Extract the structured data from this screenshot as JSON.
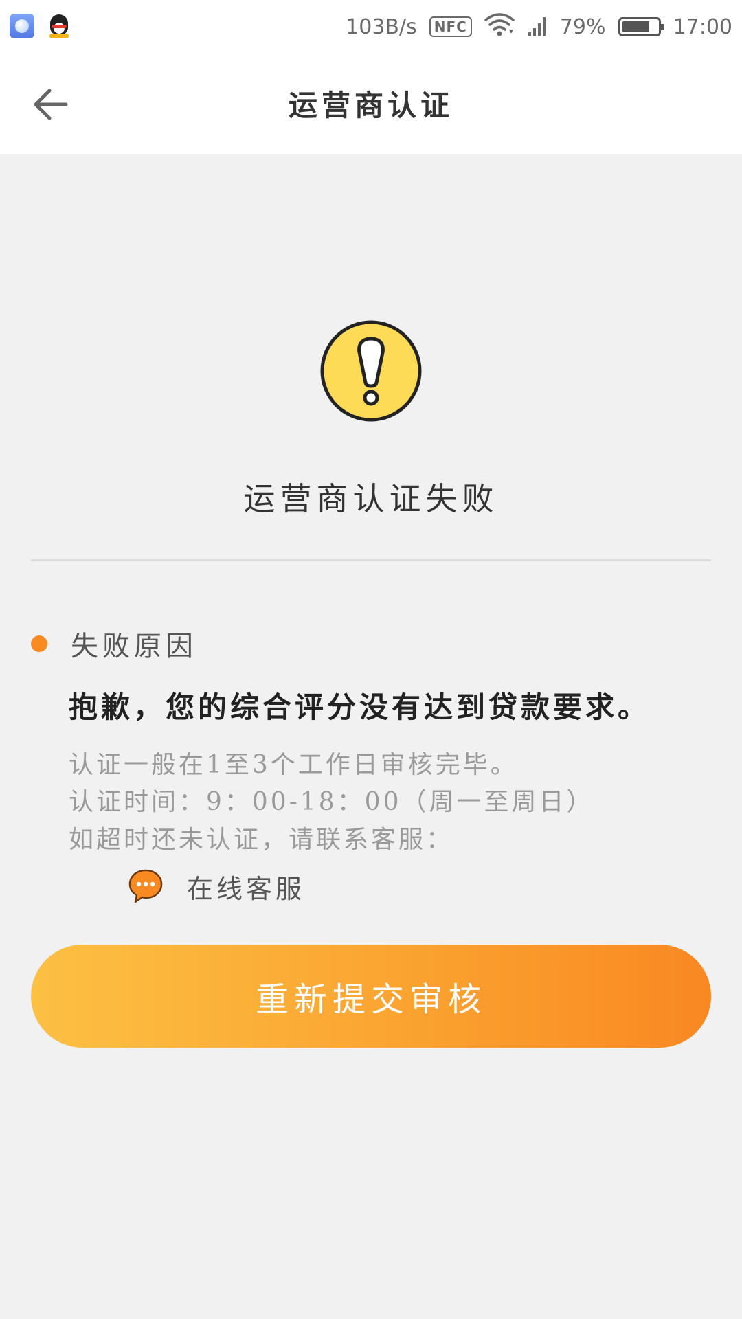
{
  "status_bar": {
    "net_speed": "103B/s",
    "nfc": "NFC",
    "battery_percent": "79%",
    "battery_level": 0.79,
    "time": "17:00",
    "left_icons": [
      "browser-app-icon",
      "qq-app-icon"
    ],
    "right_icons": [
      "wifi-icon",
      "signal-icon",
      "battery-icon"
    ]
  },
  "app_bar": {
    "back_icon": "arrow-left-icon",
    "title": "运营商认证"
  },
  "result": {
    "icon": "warning-icon",
    "title": "运营商认证失败"
  },
  "reason": {
    "label": "失败原因",
    "text": "抱歉，您的综合评分没有达到贷款要求。"
  },
  "info": {
    "line1": "认证一般在1至3个工作日审核完毕。",
    "line2": "认证时间：9：00-18：00（周一至周日）",
    "line3": "如超时还未认证，请联系客服："
  },
  "support": {
    "icon": "chat-bubble-icon",
    "label": "在线客服"
  },
  "actions": {
    "resubmit_label": "重新提交审核"
  },
  "colors": {
    "accent_orange": "#f98a22",
    "button_gradient_start": "#fcc043",
    "button_gradient_end": "#f98822",
    "warning_yellow": "#fddb56",
    "background": "#f1f1f1"
  }
}
